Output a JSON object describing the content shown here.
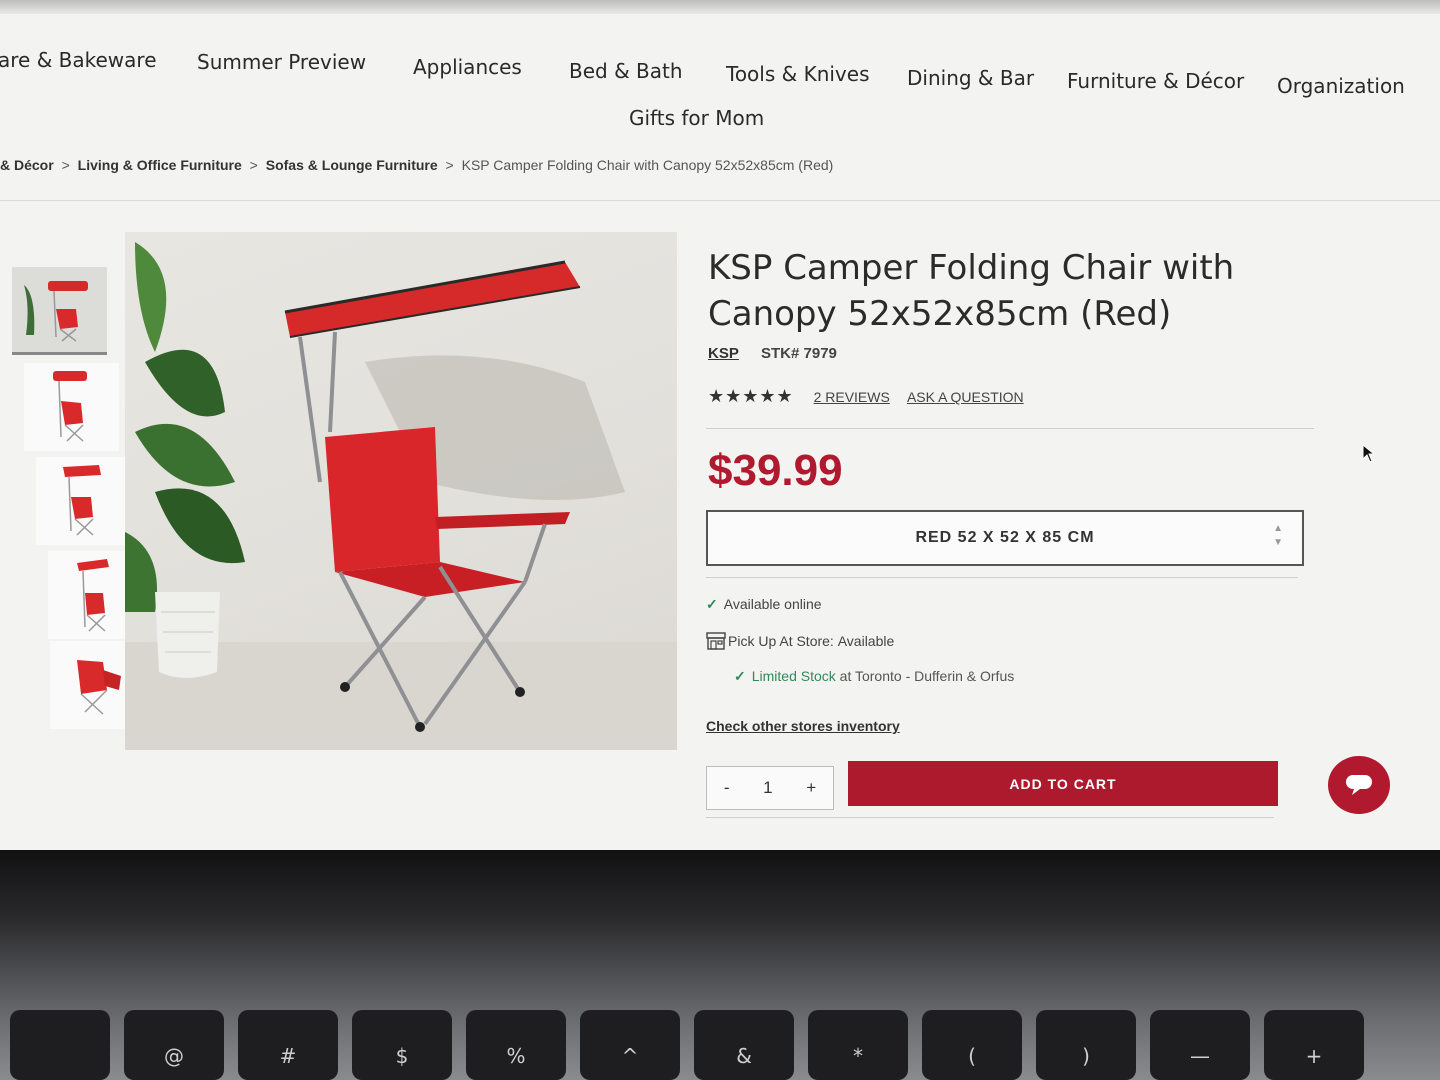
{
  "nav": {
    "items": [
      "are & Bakeware",
      "Summer Preview",
      "Appliances",
      "Bed & Bath",
      "Tools & Knives",
      "Dining & Bar",
      "Furniture & Décor",
      "Organization"
    ],
    "second_row": "Gifts for Mom"
  },
  "breadcrumb": {
    "items": [
      "& Décor",
      "Living & Office Furniture",
      "Sofas & Lounge Furniture"
    ],
    "separator": ">",
    "current": "KSP Camper Folding Chair with Canopy 52x52x85cm (Red)"
  },
  "product": {
    "title_line1": "KSP Camper Folding Chair with",
    "title_line2": "Canopy 52x52x85cm (Red)",
    "brand": "KSP",
    "stk": "STK# 7979",
    "stars": "★★★★★",
    "reviews_link": "2 REVIEWS",
    "question_link": "ASK A QUESTION",
    "price": "$39.99",
    "variant": "RED 52 X 52 X 85 CM",
    "available_online": "Available online",
    "pickup_label": "Pick Up At Store:",
    "pickup_status": "Available",
    "stock_status": "Limited Stock",
    "stock_location": "at Toronto - Dufferin & Orfus",
    "check_stores": "Check other stores inventory",
    "qty_minus": "-",
    "qty_value": "1",
    "qty_plus": "+",
    "add_to_cart": "ADD TO CART"
  },
  "colors": {
    "brand_red": "#b1192f",
    "stock_green": "#2f8a5b"
  },
  "keyboard": {
    "keys": [
      "",
      "@",
      "#",
      "$",
      "%",
      "^",
      "&",
      "*",
      "(",
      ")",
      "—",
      "+"
    ]
  }
}
